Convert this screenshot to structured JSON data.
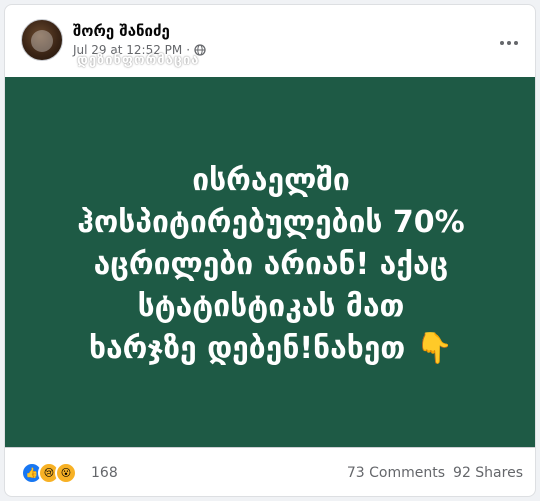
{
  "post": {
    "author": "შორე შანიძე",
    "timestamp": "Jul 29 at 12:52 PM",
    "separator": "·",
    "watermark": "დეზინფორმაცია",
    "text_lines": [
      "ისრაელში",
      "ჰოსპიტირებულების 70%",
      "აცრილები არიან! აქაც",
      "სტატისტიკას მათ",
      "ხარჯზე დებენ!ნახეთ 👇"
    ],
    "background_color": "#1e5a45"
  },
  "footer": {
    "reaction_count": "168",
    "comments": "73 Comments",
    "shares": "92 Shares",
    "reactions": [
      "like-icon",
      "sad-icon",
      "wow-icon"
    ]
  }
}
